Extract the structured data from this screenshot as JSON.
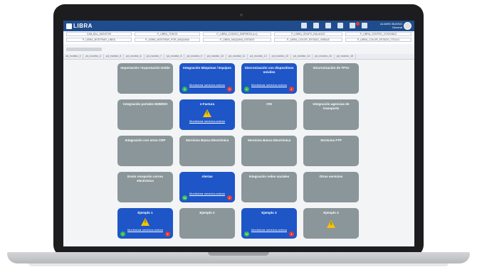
{
  "app": {
    "logo_text": "LIBRA"
  },
  "header": {
    "user_line1": "ALVARO BUENO",
    "user_line2": "General"
  },
  "filters": {
    "row1": [
      "CAB_BAL_MONITOR",
      "P_LIBRA_TODOS",
      "P_LIBRA_CODIGO_EMPRESA (x.x)",
      "P_LIBRA_GRUPO_BALANCE",
      "P_LIBRA_CENTRO_CONTABLE"
    ],
    "row2": [
      "P_LIBRA_MOSTRAR_LINEA",
      "P_LIBRA_MOSTRAR_POR_MAQUINA",
      "P_LIBRA_MAQUINA_ESTADO",
      "P_LIBRA_COLOR_ESTADO_VISIBLE",
      "P_LIBRA_COLOR_ESTADO_TITULO"
    ]
  },
  "tabs": [
    "ub_monitor_3",
    "pd_monitor_4",
    "pd_monitor_5",
    "pd_monitor_6",
    "pd_monitor_7",
    "pd_monitor_8",
    "pd_monitor_9",
    "pd_monitor_10",
    "pd_monitor_11",
    "pd_monitor_12",
    "pd_monitor_13",
    "pd_monitor_14",
    "pd_monitor_15",
    "pd_monitor_16"
  ],
  "link_text": "Monitorizar servicios activos",
  "tiles": [
    {
      "title": "Importación / Exportación Doble",
      "style": "gray"
    },
    {
      "title": "Integración Máquinas / Equipos",
      "style": "blue",
      "link": true,
      "ok": "4",
      "err": "2"
    },
    {
      "title": "Sincronización con dispositivos móviles",
      "style": "blue",
      "link": true,
      "ok": "4",
      "err": "1"
    },
    {
      "title": "Sincronización de TPVs",
      "style": "gray"
    },
    {
      "title": "Integración portales B2B/EDI",
      "style": "gray"
    },
    {
      "title": "e-Factura",
      "style": "blue",
      "link": true,
      "warn": true
    },
    {
      "title": "CRI",
      "style": "gray"
    },
    {
      "title": "Integración agencias de transporte",
      "style": "gray"
    },
    {
      "title": "Integración con otros CRP",
      "style": "gray"
    },
    {
      "title": "Servicios Banca Electrónica",
      "style": "gray"
    },
    {
      "title": "Servicios Banca Electrónica",
      "style": "gray"
    },
    {
      "title": "Servicios FTP",
      "style": "gray"
    },
    {
      "title": "Envío recepción correo electrónico",
      "style": "gray"
    },
    {
      "title": "Alertas",
      "style": "blue",
      "link": true,
      "ok": "10",
      "err": "2"
    },
    {
      "title": "Integración redes sociales",
      "style": "gray"
    },
    {
      "title": "Otros servicios",
      "style": "gray"
    },
    {
      "title": "Ejemplo 1",
      "style": "blue",
      "link": true,
      "warn": true,
      "ok": "2",
      "err": "1"
    },
    {
      "title": "Ejemplo 2",
      "style": "gray"
    },
    {
      "title": "Ejemplo 3",
      "style": "blue",
      "link": true,
      "ok": "10",
      "err": "1"
    },
    {
      "title": "Ejemplo 4",
      "style": "gray",
      "warn": true
    }
  ]
}
